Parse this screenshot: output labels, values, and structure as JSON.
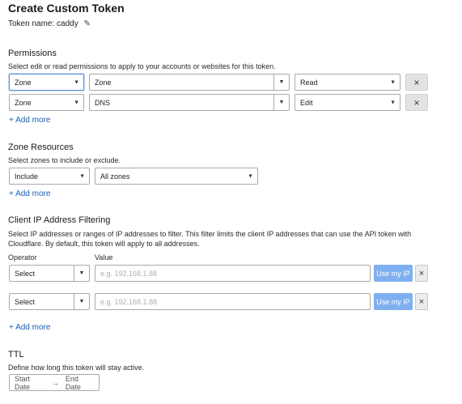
{
  "title": "Create Custom Token",
  "token_name_label": "Token name: caddy",
  "edit_icon": "pencil-icon",
  "permissions": {
    "heading": "Permissions",
    "description": "Select edit or read permissions to apply to your accounts or websites for this token.",
    "rows": [
      {
        "scope": "Zone",
        "resource": "Zone",
        "access": "Read"
      },
      {
        "scope": "Zone",
        "resource": "DNS",
        "access": "Edit"
      }
    ],
    "add_more": "+ Add more"
  },
  "zone_resources": {
    "heading": "Zone Resources",
    "description": "Select zones to include or exclude.",
    "include": "Include",
    "zones": "All zones",
    "add_more": "+ Add more"
  },
  "ip_filtering": {
    "heading": "Client IP Address Filtering",
    "description_line1": "Select IP addresses or ranges of IP addresses to filter. This filter limits the client IP addresses that can use the API token with",
    "description_line2": "Cloudflare. By default, this token will apply to all addresses.",
    "operator_label": "Operator",
    "value_label": "Value",
    "rows": [
      {
        "operator": "Select",
        "placeholder": "e.g. 192.168.1.88",
        "button": "Use my IP"
      },
      {
        "operator": "Select",
        "placeholder": "e.g. 192.168.1.88",
        "button": "Use my IP"
      }
    ],
    "add_more": "+ Add more"
  },
  "ttl": {
    "heading": "TTL",
    "description": "Define how long this token will stay active.",
    "start": "Start Date",
    "arrow": "→",
    "end": "End Date"
  },
  "icons": {
    "remove": "×",
    "caret": "▼"
  }
}
